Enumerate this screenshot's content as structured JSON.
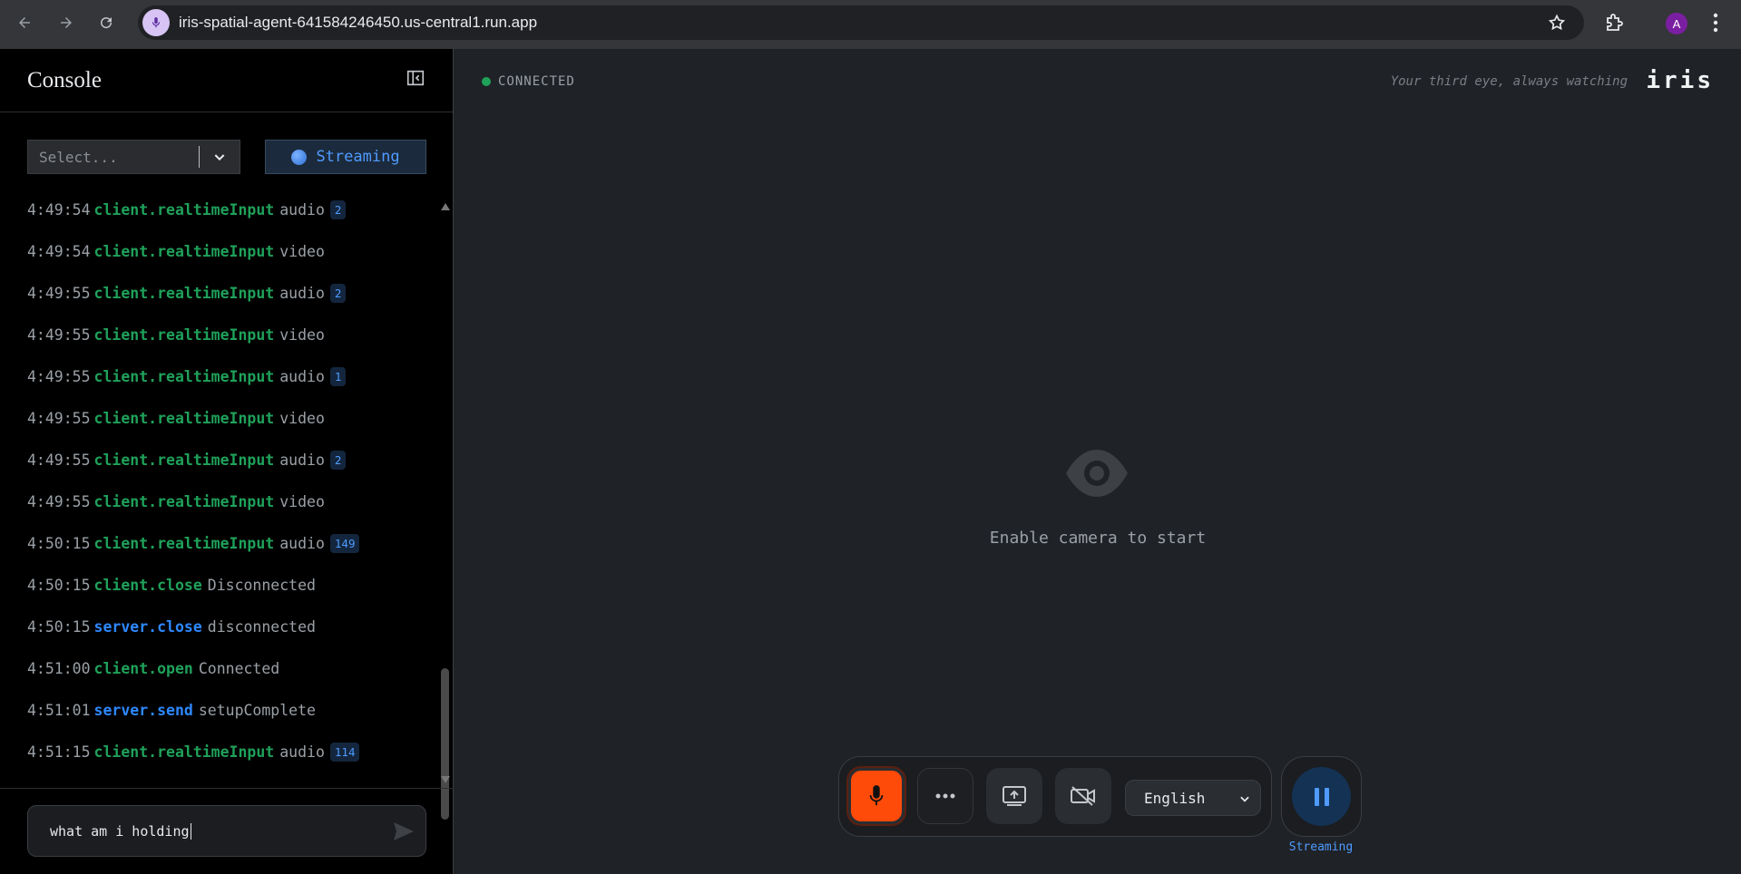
{
  "browser": {
    "url": "iris-spatial-agent-641584246450.us-central1.run.app",
    "avatar_letter": "A"
  },
  "sidebar": {
    "title": "Console",
    "select_placeholder": "Select...",
    "stream_label": "Streaming",
    "logs": [
      {
        "time": "4:49:54",
        "source": "client.realtimeInput",
        "kind": "client",
        "message": "audio",
        "count": "2"
      },
      {
        "time": "4:49:54",
        "source": "client.realtimeInput",
        "kind": "client",
        "message": "video",
        "count": ""
      },
      {
        "time": "4:49:55",
        "source": "client.realtimeInput",
        "kind": "client",
        "message": "audio",
        "count": "2"
      },
      {
        "time": "4:49:55",
        "source": "client.realtimeInput",
        "kind": "client",
        "message": "video",
        "count": ""
      },
      {
        "time": "4:49:55",
        "source": "client.realtimeInput",
        "kind": "client",
        "message": "audio",
        "count": "1"
      },
      {
        "time": "4:49:55",
        "source": "client.realtimeInput",
        "kind": "client",
        "message": "video",
        "count": ""
      },
      {
        "time": "4:49:55",
        "source": "client.realtimeInput",
        "kind": "client",
        "message": "audio",
        "count": "2"
      },
      {
        "time": "4:49:55",
        "source": "client.realtimeInput",
        "kind": "client",
        "message": "video",
        "count": ""
      },
      {
        "time": "4:50:15",
        "source": "client.realtimeInput",
        "kind": "client",
        "message": "audio",
        "count": "149"
      },
      {
        "time": "4:50:15",
        "source": "client.close",
        "kind": "client",
        "message": "Disconnected",
        "count": ""
      },
      {
        "time": "4:50:15",
        "source": "server.close",
        "kind": "server",
        "message": "disconnected",
        "count": ""
      },
      {
        "time": "4:51:00",
        "source": "client.open",
        "kind": "client",
        "message": "Connected",
        "count": ""
      },
      {
        "time": "4:51:01",
        "source": "server.send",
        "kind": "server",
        "message": "setupComplete",
        "count": ""
      },
      {
        "time": "4:51:15",
        "source": "client.realtimeInput",
        "kind": "client",
        "message": "audio",
        "count": "114"
      }
    ],
    "chat_value": "what am i holding"
  },
  "main": {
    "status": "CONNECTED",
    "tagline": "Your third eye, always watching",
    "brand": "iris",
    "placeholder_text": "Enable camera to start",
    "language": "English",
    "stream_caption": "Streaming"
  },
  "colors": {
    "accent_blue": "#4f9bff",
    "client_green": "#1fa15a",
    "mic_orange": "#ff4b0a"
  }
}
